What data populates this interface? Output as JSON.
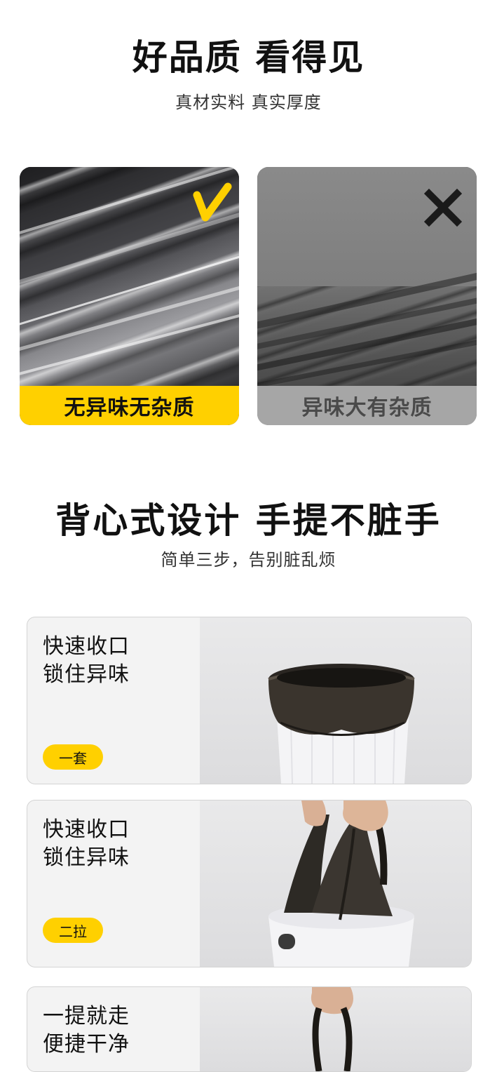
{
  "section1": {
    "title": "好品质 看得见",
    "subtitle": "真材实料 真实厚度",
    "good_card": {
      "label": "无异味无杂质",
      "mark_icon": "check-icon",
      "accent": "#ffd000"
    },
    "bad_card": {
      "label": "异味大有杂质",
      "mark_icon": "cross-icon",
      "accent": "#a6a6a6"
    }
  },
  "section2": {
    "title": "背心式设计 手提不脏手",
    "subtitle": "简单三步，告别脏乱烦",
    "steps": [
      {
        "line1": "快速收口",
        "line2": "锁住异味",
        "badge": "一套"
      },
      {
        "line1": "快速收口",
        "line2": "锁住异味",
        "badge": "二拉"
      },
      {
        "line1": "一提就走",
        "line2": "便捷干净"
      }
    ]
  },
  "colors": {
    "brand_yellow": "#ffd000",
    "card_border": "#d4d4d4",
    "text_dark": "#111111"
  }
}
